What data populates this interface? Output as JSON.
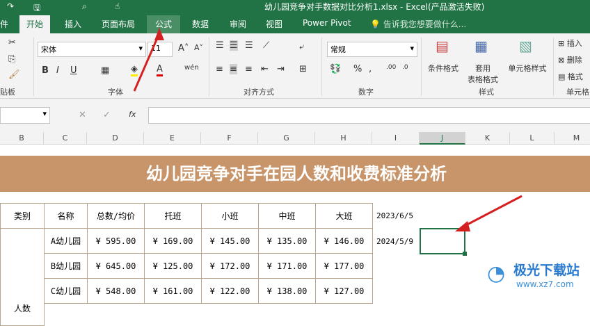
{
  "window": {
    "title": "幼儿园竞争对手数据对比分析1.xlsx - Excel(产品激活失败)"
  },
  "tabs": [
    "件",
    "开始",
    "插入",
    "页面布局",
    "公式",
    "数据",
    "审阅",
    "视图",
    "Power Pivot"
  ],
  "tell_me": "告诉我您想要做什么...",
  "ribbon": {
    "font_name": "宋体",
    "font_size": "11",
    "number_format": "常规",
    "conditional": "条件格式",
    "table_format_1": "套用",
    "table_format_2": "表格格式",
    "cell_style": "单元格样式",
    "insert": "插入",
    "delete": "删除",
    "format": "格式",
    "groups": [
      "贴板",
      "字体",
      "对齐方式",
      "数字",
      "样式",
      "单元格"
    ]
  },
  "formula_bar": {
    "fx": "fx",
    "value": ""
  },
  "columns": [
    "B",
    "C",
    "D",
    "E",
    "F",
    "G",
    "H",
    "I",
    "J",
    "K",
    "L",
    "M"
  ],
  "banner": "幼儿园竞争对手在园人数和收费标准分析",
  "table": {
    "headers": [
      "类别",
      "名称",
      "总数/均价",
      "托班",
      "小班",
      "中班",
      "大班"
    ],
    "category": "人数",
    "rows": [
      [
        "A幼儿园",
        "¥ 595.00",
        "¥ 169.00",
        "¥ 145.00",
        "¥ 135.00",
        "¥ 146.00"
      ],
      [
        "B幼儿园",
        "¥ 645.00",
        "¥ 125.00",
        "¥ 172.00",
        "¥ 171.00",
        "¥ 177.00"
      ],
      [
        "C幼儿园",
        "¥ 548.00",
        "¥ 161.00",
        "¥ 122.00",
        "¥ 138.00",
        "¥ 127.00"
      ]
    ]
  },
  "dates": [
    "2023/6/5",
    "2024/5/9"
  ],
  "watermark": {
    "name": "极光下载站",
    "url": "www.xz7.com"
  }
}
